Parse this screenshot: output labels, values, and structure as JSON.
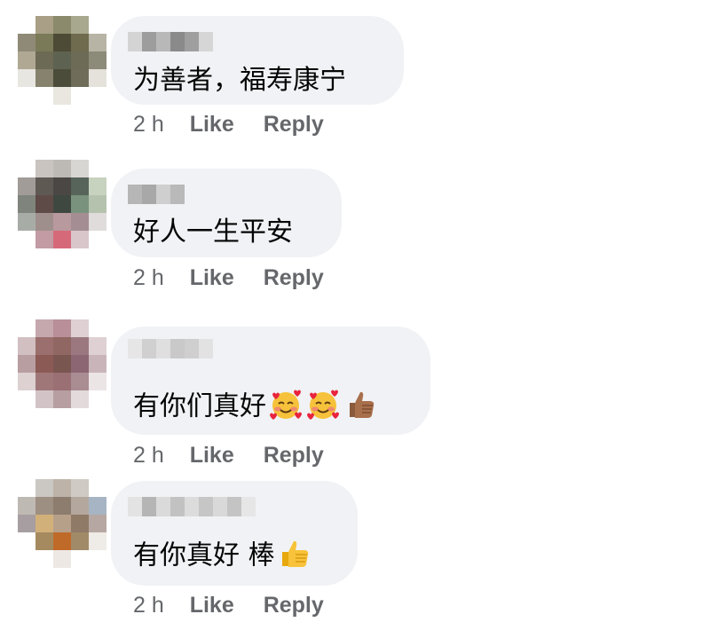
{
  "colors": {
    "bubble_bg": "#f0f2f5",
    "meta_text": "#65676b",
    "comment_text": "#050505"
  },
  "comments": [
    {
      "author_name": "",
      "text": "为善者，福寿康宁",
      "emojis": [],
      "time": "2 h",
      "like_label": "Like",
      "reply_label": "Reply"
    },
    {
      "author_name": "",
      "text": "好人一生平安",
      "emojis": [],
      "time": "2 h",
      "like_label": "Like",
      "reply_label": "Reply"
    },
    {
      "author_name": "",
      "text": "有你们真好",
      "emojis": [
        "smiling-face-with-hearts-icon",
        "smiling-face-with-hearts-icon",
        "thumbs-up-medium-skin-icon"
      ],
      "time": "2 h",
      "like_label": "Like",
      "reply_label": "Reply"
    },
    {
      "author_name": "",
      "text": "有你真好 棒",
      "emojis": [
        "thumbs-up-icon"
      ],
      "time": "2 h",
      "like_label": "Like",
      "reply_label": "Reply"
    }
  ]
}
